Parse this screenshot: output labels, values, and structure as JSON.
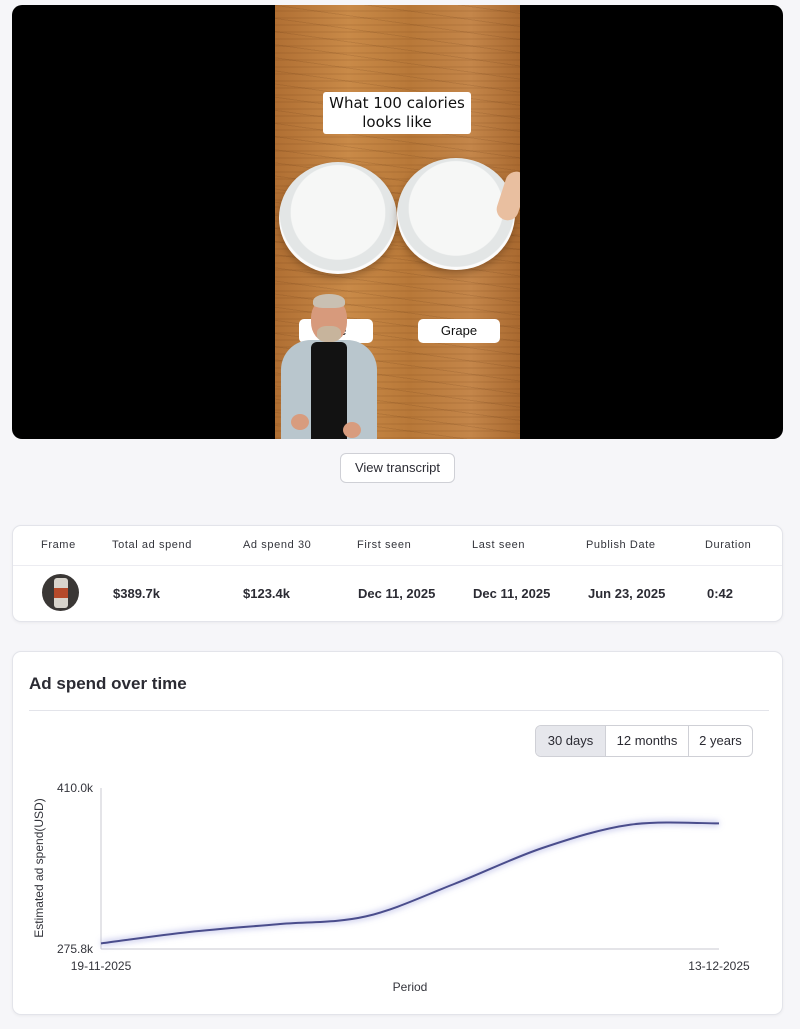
{
  "video": {
    "caption_line1": "What 100 calories",
    "caption_line2": "looks like",
    "label_left": "ese",
    "label_right": "Grape"
  },
  "transcript_button": "View transcript",
  "stats": {
    "headers": [
      "Frame",
      "Total ad spend",
      "Ad spend 30",
      "First seen",
      "Last seen",
      "Publish Date",
      "Duration"
    ],
    "values": [
      "$389.7k",
      "$123.4k",
      "Dec 11, 2025",
      "Dec 11, 2025",
      "Jun 23, 2025",
      "0:42"
    ]
  },
  "chart": {
    "title": "Ad spend over time",
    "ranges": [
      "30 days",
      "12 months",
      "2 years"
    ],
    "active_range": "30 days"
  },
  "chart_data": {
    "type": "line",
    "title": "",
    "xlabel": "Period",
    "ylabel": "Estimated ad spend(USD)",
    "x": [
      "19-11-2025",
      "23-11-2025",
      "27-11-2025",
      "01-12-2025",
      "04-12-2025",
      "07-12-2025",
      "10-12-2025",
      "13-12-2025"
    ],
    "values": [
      280.5,
      290.0,
      296.5,
      303.0,
      330.0,
      360.0,
      379.5,
      380.5
    ],
    "x_ticks": [
      "19-11-2025",
      "13-12-2025"
    ],
    "y_ticks": [
      "275.8k",
      "410.0k"
    ],
    "ylim": [
      275.8,
      410.0
    ],
    "line_color": "#4a4d8c",
    "grid": false
  }
}
